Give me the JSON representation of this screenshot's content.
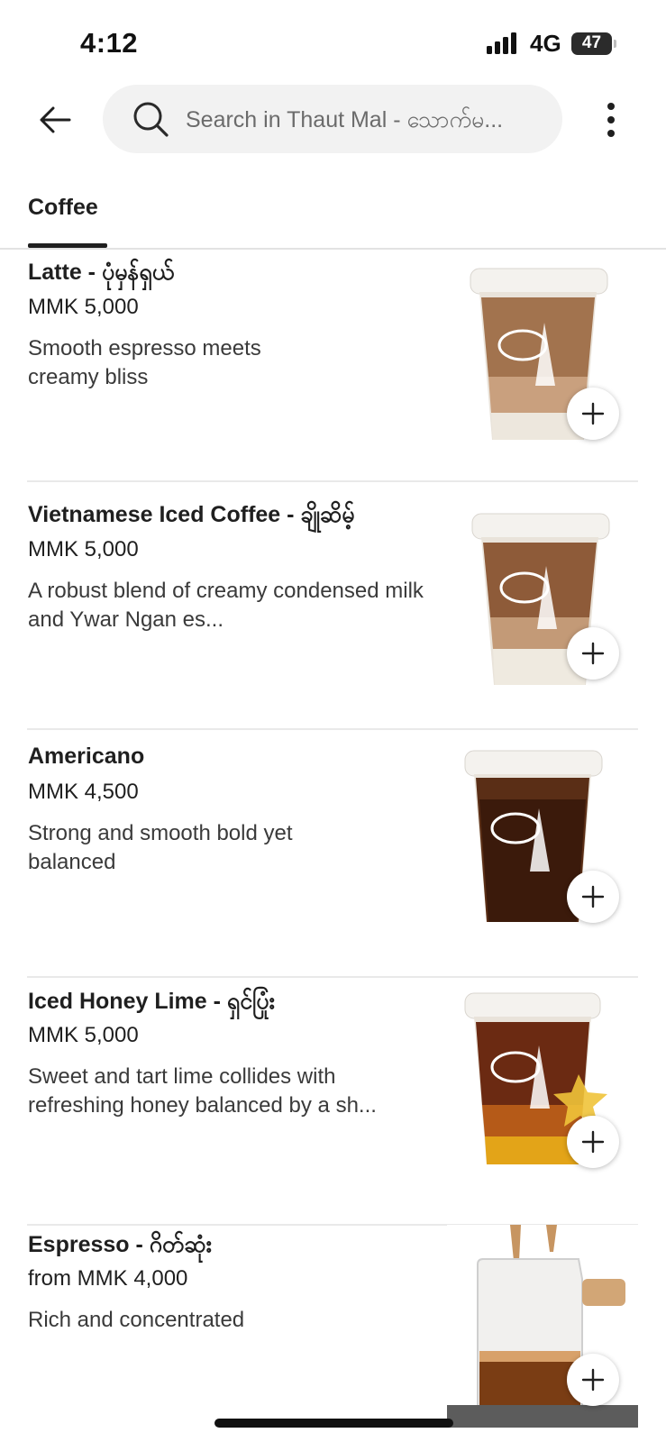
{
  "status_bar": {
    "time": "4:12",
    "network": "4G",
    "battery": "47"
  },
  "header": {
    "search_placeholder": "Search in Thaut Mal - သောက်မ..."
  },
  "tabs": [
    {
      "label": "Coffee",
      "active": true
    }
  ],
  "menu_items": [
    {
      "name": "Latte - ပုံမှန်ရှယ်",
      "price": "MMK 5,000",
      "description": "Smooth espresso meets creamy bliss",
      "image": "latte-iced-cup"
    },
    {
      "name": "Vietnamese Iced Coffee - ချိုဆိမ့်",
      "price": "MMK 5,000",
      "description": "A robust blend of creamy condensed milk and Ywar Ngan es...",
      "image": "vietnamese-iced-coffee-cup"
    },
    {
      "name": "Americano",
      "price": "MMK 4,500",
      "description": "Strong and smooth bold yet balanced",
      "image": "americano-iced-cup"
    },
    {
      "name": "Iced Honey Lime -  ရှင်ပြုံး",
      "price": "MMK 5,000",
      "description": "Sweet and tart lime collides with refreshing honey balanced by a sh...",
      "image": "honey-lime-cup"
    },
    {
      "name": "Espresso - ဂိတ်ဆုံး",
      "price": "from MMK 4,000",
      "description": "Rich and concentrated",
      "image": "espresso-glass"
    }
  ],
  "colors": {
    "text": "#1f1f1f",
    "muted": "#6b6b6b",
    "pill": "#f2f2f2",
    "divider": "#e9e9e9"
  }
}
